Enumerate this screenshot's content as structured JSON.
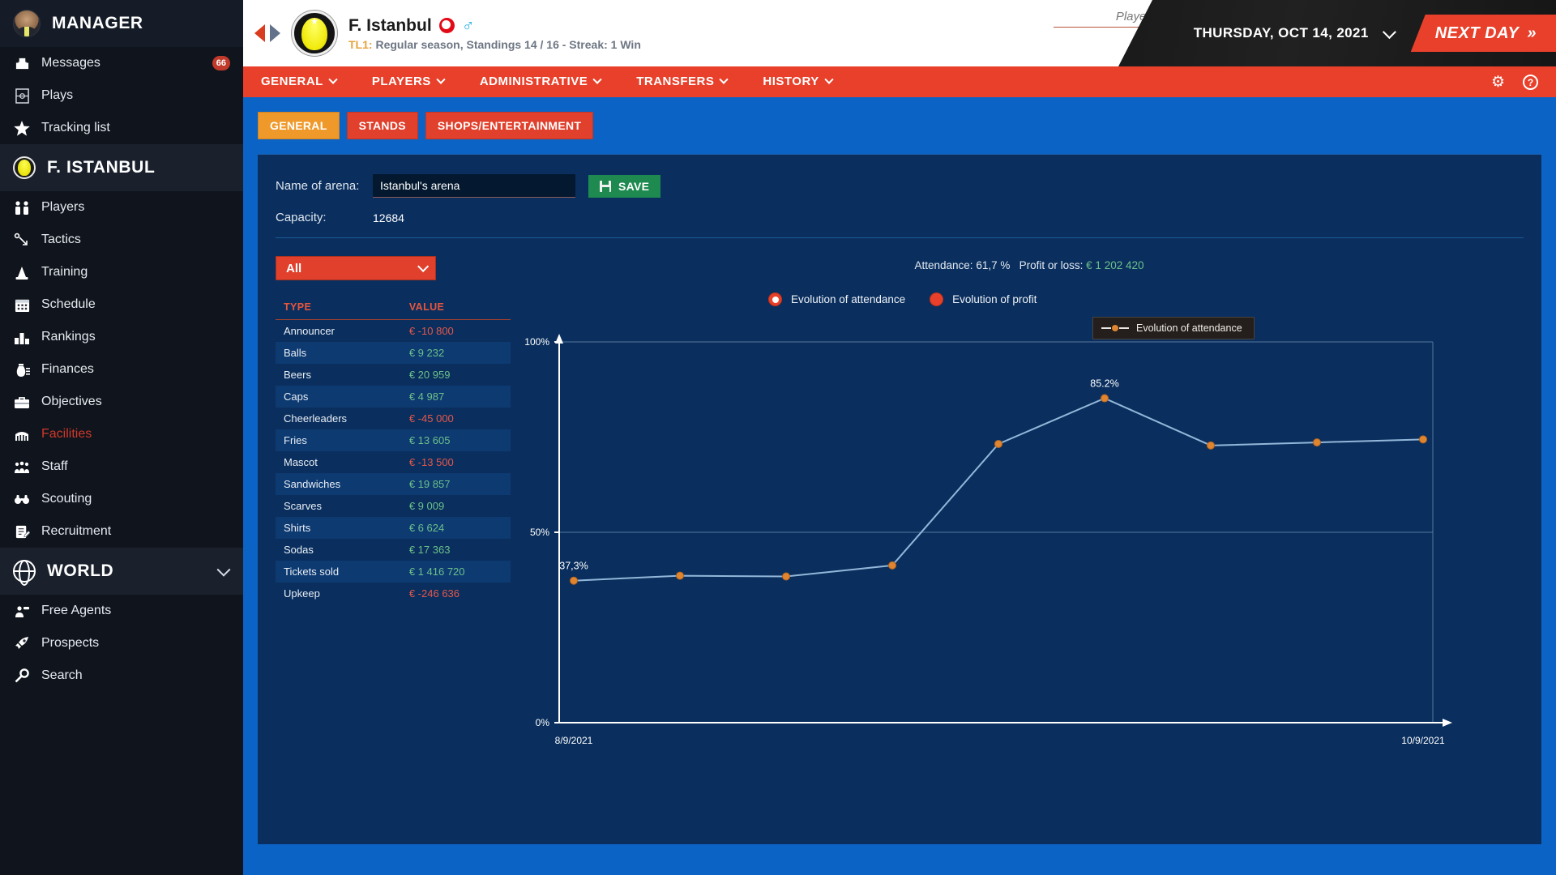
{
  "sidebar": {
    "manager": {
      "label": "MANAGER",
      "icon": "avatar-icon"
    },
    "manager_items": [
      {
        "label": "Messages",
        "icon": "inbox-icon",
        "badge": "66"
      },
      {
        "label": "Plays",
        "icon": "playbook-icon",
        "badge": ""
      },
      {
        "label": "Tracking list",
        "icon": "star-icon",
        "badge": ""
      }
    ],
    "club": {
      "label": "F. ISTANBUL",
      "icon": "club-logo-icon"
    },
    "club_items": [
      {
        "label": "Players",
        "icon": "people-icon",
        "active": false
      },
      {
        "label": "Tactics",
        "icon": "tactics-icon",
        "active": false
      },
      {
        "label": "Training",
        "icon": "cone-icon",
        "active": false
      },
      {
        "label": "Schedule",
        "icon": "calendar-icon",
        "active": false
      },
      {
        "label": "Rankings",
        "icon": "podium-icon",
        "active": false
      },
      {
        "label": "Finances",
        "icon": "moneybag-icon",
        "active": false
      },
      {
        "label": "Objectives",
        "icon": "briefcase-icon",
        "active": false
      },
      {
        "label": "Facilities",
        "icon": "stadium-icon",
        "active": true
      },
      {
        "label": "Staff",
        "icon": "staff-icon",
        "active": false
      },
      {
        "label": "Scouting",
        "icon": "binoculars-icon",
        "active": false
      },
      {
        "label": "Recruitment",
        "icon": "clipboard-icon",
        "active": false
      }
    ],
    "world": {
      "label": "WORLD",
      "icon": "globe-icon"
    },
    "world_items": [
      {
        "label": "Free Agents",
        "icon": "free-agent-icon"
      },
      {
        "label": "Prospects",
        "icon": "rocket-icon"
      },
      {
        "label": "Search",
        "icon": "magnifier-icon"
      }
    ]
  },
  "header": {
    "club_name": "F. Istanbul",
    "flag": "turkey-flag-icon",
    "gender": "♂",
    "league_tag": "TL1:",
    "league_info": "Regular season, Standings 14 / 16 - Streak: 1 Win",
    "search_placeholder": "Player, Team, Coach...",
    "search_value": "",
    "date": "THURSDAY, OCT 14, 2021",
    "next_day": "NEXT DAY",
    "next_day_icon": "»"
  },
  "menubar": {
    "items": [
      {
        "label": "GENERAL"
      },
      {
        "label": "PLAYERS"
      },
      {
        "label": "ADMINISTRATIVE"
      },
      {
        "label": "TRANSFERS"
      },
      {
        "label": "HISTORY"
      }
    ],
    "right_icons": [
      {
        "name": "gear-icon",
        "glyph": "⚙"
      },
      {
        "name": "help-icon",
        "glyph": "?"
      }
    ]
  },
  "tabs": [
    {
      "label": "GENERAL",
      "active": true
    },
    {
      "label": "STANDS",
      "active": false
    },
    {
      "label": "SHOPS/ENTERTAINMENT",
      "active": false
    }
  ],
  "form": {
    "arena_label": "Name of arena:",
    "arena_value": "Istanbul's arena",
    "arena_placeholder": "",
    "save_label": "SAVE",
    "capacity_label": "Capacity:",
    "capacity_value": "12684"
  },
  "filter": {
    "selected": "All"
  },
  "table": {
    "headers": [
      "TYPE",
      "VALUE"
    ],
    "rows": [
      {
        "type": "Announcer",
        "value": "€ -10 800",
        "negative": true
      },
      {
        "type": "Balls",
        "value": "€ 9 232",
        "negative": false
      },
      {
        "type": "Beers",
        "value": "€ 20 959",
        "negative": false
      },
      {
        "type": "Caps",
        "value": "€ 4 987",
        "negative": false
      },
      {
        "type": "Cheerleaders",
        "value": "€ -45 000",
        "negative": true
      },
      {
        "type": "Fries",
        "value": "€ 13 605",
        "negative": false
      },
      {
        "type": "Mascot",
        "value": "€ -13 500",
        "negative": true
      },
      {
        "type": "Sandwiches",
        "value": "€ 19 857",
        "negative": false
      },
      {
        "type": "Scarves",
        "value": "€ 9 009",
        "negative": false
      },
      {
        "type": "Shirts",
        "value": "€ 6 624",
        "negative": false
      },
      {
        "type": "Sodas",
        "value": "€ 17 363",
        "negative": false
      },
      {
        "type": "Tickets sold",
        "value": "€ 1 416 720",
        "negative": false
      },
      {
        "type": "Upkeep",
        "value": "€ -246 636",
        "negative": true
      }
    ]
  },
  "stats": {
    "attendance_label": "Attendance:",
    "attendance_value": "61,7 %",
    "profit_label": "Profit or loss:",
    "profit_value": "€ 1 202 420"
  },
  "chart_options": [
    {
      "label": "Evolution of attendance",
      "selected": true
    },
    {
      "label": "Evolution of profit",
      "selected": false
    }
  ],
  "chart_data": {
    "type": "line",
    "title": "Evolution of attendance",
    "legend": "Evolution of attendance",
    "legend_position": "top-right",
    "xlabel": "",
    "ylabel": "",
    "ylim": [
      0,
      100
    ],
    "yticks": [
      "0%",
      "50%",
      "100%"
    ],
    "ytick_values": [
      0,
      50,
      100
    ],
    "grid": false,
    "xticks": [
      "8/9/2021",
      "10/9/2021"
    ],
    "x": [
      "8/9/2021",
      "",
      "",
      "",
      "",
      "",
      "",
      "",
      "10/9/2021"
    ],
    "series": [
      {
        "name": "Evolution of attendance",
        "color": "#e0852f",
        "line_color": "#93b7d9",
        "values": [
          37.3,
          38.6,
          38.4,
          41.3,
          73.2,
          85.2,
          72.8,
          73.6,
          74.4
        ]
      }
    ],
    "annotations": [
      {
        "text": "37,3%",
        "value": 37.3,
        "index": 0
      },
      {
        "text": "85.2%",
        "value": 85.2,
        "index": 5
      }
    ]
  }
}
